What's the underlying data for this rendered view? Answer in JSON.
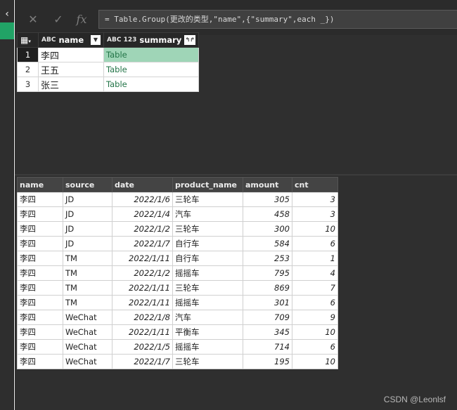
{
  "formula_bar": {
    "cancel_icon": "✕",
    "confirm_icon": "✓",
    "fx_label": "fx",
    "formula": "= Table.Group(更改的类型,\"name\",{\"summary\",each _})"
  },
  "nav": {
    "toggle_icon": "‹"
  },
  "grouped_table": {
    "headers": {
      "name": "name",
      "summary": "summary",
      "name_type": "ABC",
      "summary_type": "ABC 123"
    },
    "rows": [
      {
        "num": "1",
        "name": "李四",
        "summary": "Table"
      },
      {
        "num": "2",
        "name": "王五",
        "summary": "Table"
      },
      {
        "num": "3",
        "name": "张三",
        "summary": "Table"
      }
    ]
  },
  "detail_table": {
    "headers": [
      "name",
      "source",
      "date",
      "product_name",
      "amount",
      "cnt"
    ],
    "rows": [
      [
        "李四",
        "JD",
        "2022/1/6",
        "三轮车",
        "305",
        "3"
      ],
      [
        "李四",
        "JD",
        "2022/1/4",
        "汽车",
        "458",
        "3"
      ],
      [
        "李四",
        "JD",
        "2022/1/2",
        "三轮车",
        "300",
        "10"
      ],
      [
        "李四",
        "JD",
        "2022/1/7",
        "自行车",
        "584",
        "6"
      ],
      [
        "李四",
        "TM",
        "2022/1/11",
        "自行车",
        "253",
        "1"
      ],
      [
        "李四",
        "TM",
        "2022/1/2",
        "摇摇车",
        "795",
        "4"
      ],
      [
        "李四",
        "TM",
        "2022/1/11",
        "三轮车",
        "869",
        "7"
      ],
      [
        "李四",
        "TM",
        "2022/1/11",
        "摇摇车",
        "301",
        "6"
      ],
      [
        "李四",
        "WeChat",
        "2022/1/8",
        "汽车",
        "709",
        "9"
      ],
      [
        "李四",
        "WeChat",
        "2022/1/11",
        "平衡车",
        "345",
        "10"
      ],
      [
        "李四",
        "WeChat",
        "2022/1/5",
        "摇摇车",
        "714",
        "6"
      ],
      [
        "李四",
        "WeChat",
        "2022/1/7",
        "三轮车",
        "195",
        "10"
      ]
    ]
  },
  "watermark": "CSDN @Leonlsf",
  "colors": {
    "accent": "#21a366",
    "selected_cell": "#9fd5b7",
    "table_link": "#217346"
  }
}
